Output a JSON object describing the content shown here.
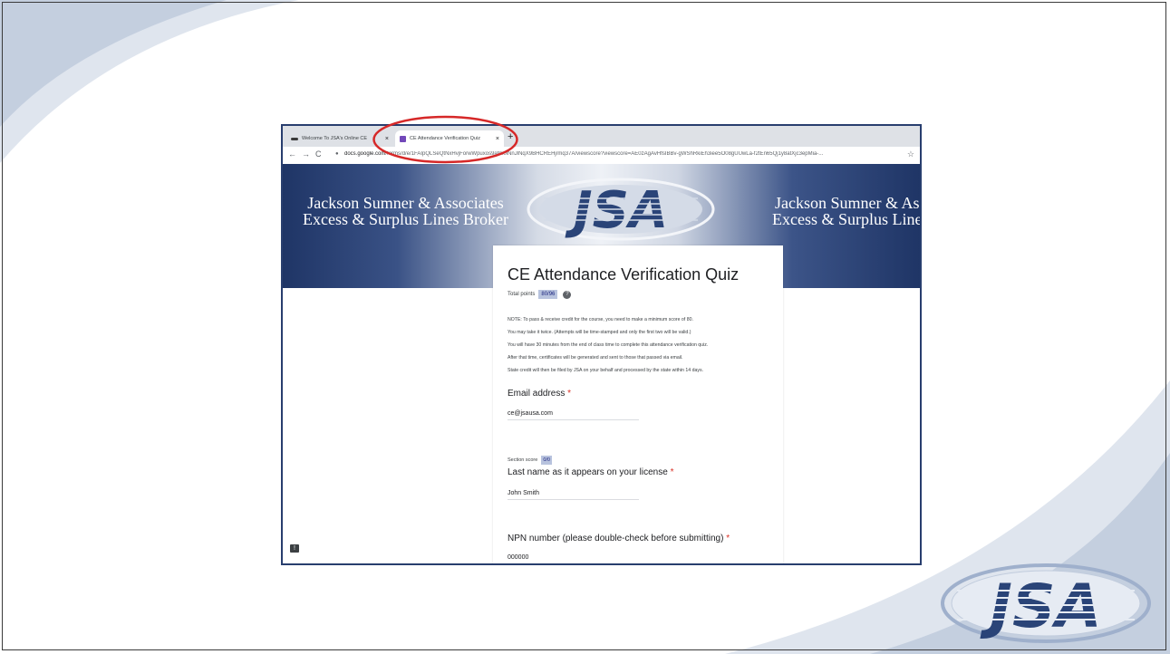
{
  "browser": {
    "tabs": [
      {
        "title": "Welcome To JSA's Online CE"
      },
      {
        "title": "CE Attendance Verification Quiz"
      }
    ],
    "close_glyph": "×",
    "new_tab_glyph": "+",
    "url_host": "docs.google.com",
    "url_path": "/forms/d/e/1FAIpQLSeQtNxHvjForwWpuxos9afrk0lNnJlNqX9BHCREHj/mq37A/viewscore?viewscore=AE0zAgAvHfsIBBv-gWShRkiEh3iee5O08gUUwLa-f2tEn65Qj1y8atXjc3epMia-...",
    "icons": {
      "back": "arrow-left-icon",
      "forward": "arrow-right-icon",
      "reload": "reload-icon",
      "lock": "lock-icon",
      "bookmark": "star-icon"
    }
  },
  "banner": {
    "left_line1": "Jackson Sumner & Associates",
    "left_line2": "Excess & Surplus Lines Broker",
    "right_line1": "Jackson Sumner & Ass",
    "right_line2": "Excess & Surplus Lines",
    "logo_text": "JSA",
    "color_dark": "#1f3566",
    "color_light": "#eef1f6"
  },
  "form": {
    "title": "CE Attendance Verification Quiz",
    "total_points_label": "Total points",
    "total_points_value": "80/96",
    "help_glyph": "?",
    "notes": [
      "NOTE: To pass & receive credit for the course, you need to make a minimum score of 80.",
      "You may take it twice. (Attempts will be time-stamped and only the first two will be valid.)",
      "You will have 30 minutes from the end of class time to complete this attendance verification quiz.",
      "After that time, certificates will be generated and sent to those that passed via email.",
      "State credit will then be filed by JSA on your behalf and processed by the state within 14 days."
    ],
    "email_label": "Email address",
    "email_value": "ce@jsausa.com",
    "required_mark": "*",
    "section_score_label": "Section score",
    "section_score_value": "0/0",
    "lastname_label": "Last name as it appears on your license",
    "lastname_value": "John Smith",
    "npn_label": "NPN number (please double-check before submitting)",
    "npn_value": "000000",
    "accent_color": "#b8c3de",
    "required_color": "#d93025"
  },
  "slide": {
    "corner_logo_text": "JSA",
    "annotation_color": "#d62828"
  }
}
